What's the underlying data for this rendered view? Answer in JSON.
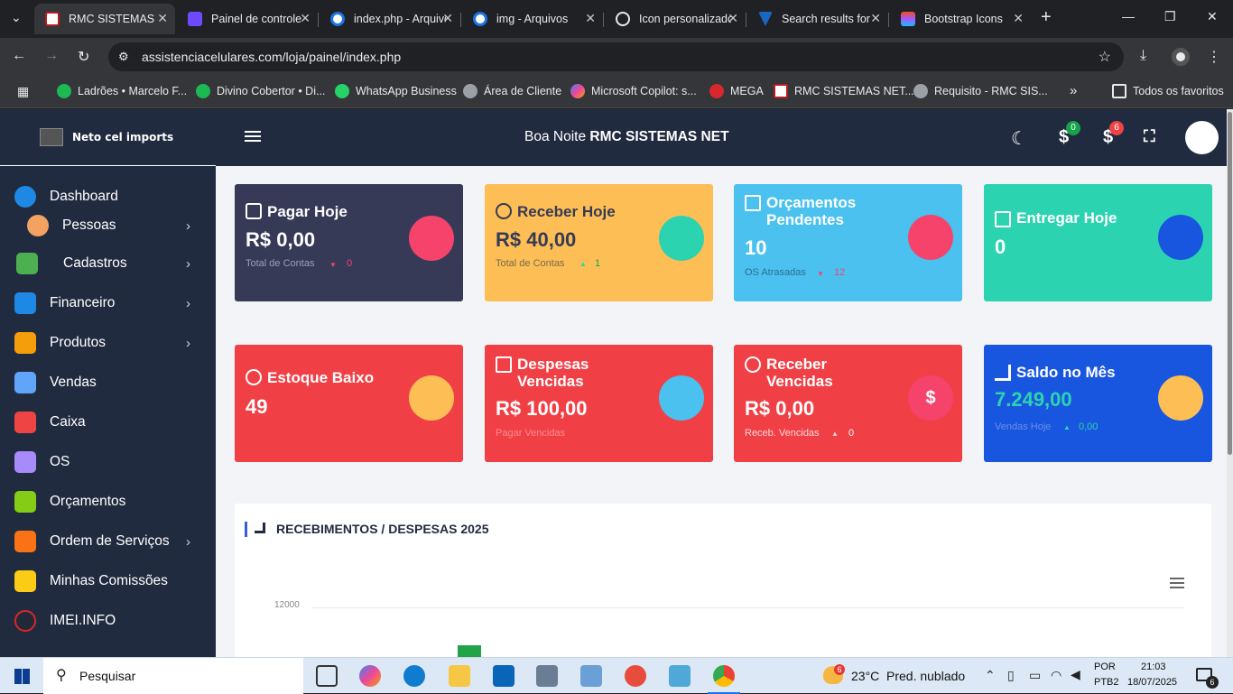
{
  "browser": {
    "tabs": [
      {
        "label": "RMC SISTEMAS",
        "active": true,
        "icon": "rmc-icon"
      },
      {
        "label": "Painel de controle",
        "active": false,
        "icon": "panel-icon"
      },
      {
        "label": "index.php - Arquivos",
        "active": false,
        "icon": "globe-icon"
      },
      {
        "label": "img - Arquivos",
        "active": false,
        "icon": "globe-icon"
      },
      {
        "label": "Icon personalizado",
        "active": false,
        "icon": "chatgpt-icon"
      },
      {
        "label": "Search results for",
        "active": false,
        "icon": "vuetify-icon"
      },
      {
        "label": "Bootstrap Icons",
        "active": false,
        "icon": "figma-icon"
      }
    ],
    "new_tab": "+",
    "url": "assistenciacelulares.com/loja/painel/index.php",
    "bookmarks": [
      {
        "label": "Ladrões • Marcelo F...",
        "color": "#1db954"
      },
      {
        "label": "Divino Cobertor • Di...",
        "color": "#1db954"
      },
      {
        "label": "WhatsApp Business",
        "color": "#25d366"
      },
      {
        "label": "Área de Cliente",
        "color": "#9aa0a6"
      },
      {
        "label": "Microsoft Copilot: s...",
        "color": "#3b82f6"
      },
      {
        "label": "MEGA",
        "color": "#d9272e"
      },
      {
        "label": "RMC SISTEMAS NET...",
        "color": "#b91c1c"
      },
      {
        "label": "Requisito - RMC SIS...",
        "color": "#9aa0a6"
      }
    ],
    "all_favorites": "Todos os favoritos"
  },
  "sidebar": {
    "brand": "Neto cel imports",
    "items": [
      {
        "label": "Dashboard",
        "icon": "home-icon",
        "arrow": false
      },
      {
        "label": "Pessoas",
        "icon": "people-icon",
        "arrow": true
      },
      {
        "label": "Cadastros",
        "icon": "register-icon",
        "arrow": true
      },
      {
        "label": "Financeiro",
        "icon": "finance-icon",
        "arrow": true
      },
      {
        "label": "Produtos",
        "icon": "products-icon",
        "arrow": true
      },
      {
        "label": "Vendas",
        "icon": "sales-icon",
        "arrow": false
      },
      {
        "label": "Caixa",
        "icon": "cashier-icon",
        "arrow": false
      },
      {
        "label": "OS",
        "icon": "os-icon",
        "arrow": false
      },
      {
        "label": "Orçamentos",
        "icon": "budget-icon",
        "arrow": false
      },
      {
        "label": "Ordem de Serviços",
        "icon": "service-order-icon",
        "arrow": true
      },
      {
        "label": "Minhas Comissões",
        "icon": "commission-icon",
        "arrow": false
      },
      {
        "label": "IMEI.INFO",
        "icon": "imei-icon",
        "arrow": false
      }
    ]
  },
  "header": {
    "greeting_prefix": "Boa Noite",
    "greeting_name": "RMC SISTEMAS NET",
    "badge_green": "0",
    "badge_red": "6"
  },
  "cards": [
    {
      "title": "Pagar Hoje",
      "value": "R$ 0,00",
      "sub": "Total de Contas",
      "arrow": "down",
      "num": "0",
      "bg": "#363a56",
      "circle": "#f5436c"
    },
    {
      "title": "Receber Hoje",
      "value": "R$ 40,00",
      "sub": "Total de Contas",
      "arrow": "up",
      "num": "1",
      "bg": "#fdbe55",
      "circle": "#2cd3b1"
    },
    {
      "title": "Orçamentos Pendentes",
      "value": "10",
      "sub": "OS Atrasadas",
      "arrow": "down",
      "num": "12",
      "bg": "#4ac1ee",
      "circle": "#f5436c"
    },
    {
      "title": "Entregar Hoje",
      "value": "0",
      "sub": "",
      "arrow": "",
      "num": "",
      "bg": "#2cd3b1",
      "circle": "#1956e0"
    },
    {
      "title": "Estoque Baixo",
      "value": "49",
      "sub": "",
      "arrow": "",
      "num": "",
      "bg": "#f04046",
      "circle": "#fdbe55"
    },
    {
      "title": "Despesas Vencidas",
      "value": "R$ 100,00",
      "sub": "Pagar Vencidas",
      "arrow": "",
      "num": "",
      "bg": "#f04046",
      "circle": "#4ac1ee"
    },
    {
      "title": "Receber Vencidas",
      "value": "R$ 0,00",
      "sub": "Receb. Vencidas",
      "arrow": "up",
      "num": "0",
      "bg": "#f04046",
      "circle": "#f5436c"
    },
    {
      "title": "Saldo no Mês",
      "value": "7.249,00",
      "sub": "Vendas Hoje",
      "arrow": "up",
      "num": "0,00",
      "bg": "#1956e0",
      "circle": "#fdbe55"
    }
  ],
  "chart": {
    "title": "RECEBIMENTOS / DESPESAS 2025"
  },
  "chart_data": {
    "type": "bar",
    "title": "RECEBIMENTOS / DESPESAS 2025",
    "yticks": [
      "12000"
    ],
    "series_colors": [
      "#22a348"
    ]
  },
  "taskbar": {
    "search": "Pesquisar",
    "weather_temp": "23°C",
    "weather_text": "Pred. nublado",
    "weather_badge": "6",
    "lang_1": "POR",
    "lang_2": "PTB2",
    "time": "21:03",
    "date": "18/07/2025",
    "notif_count": "6"
  }
}
